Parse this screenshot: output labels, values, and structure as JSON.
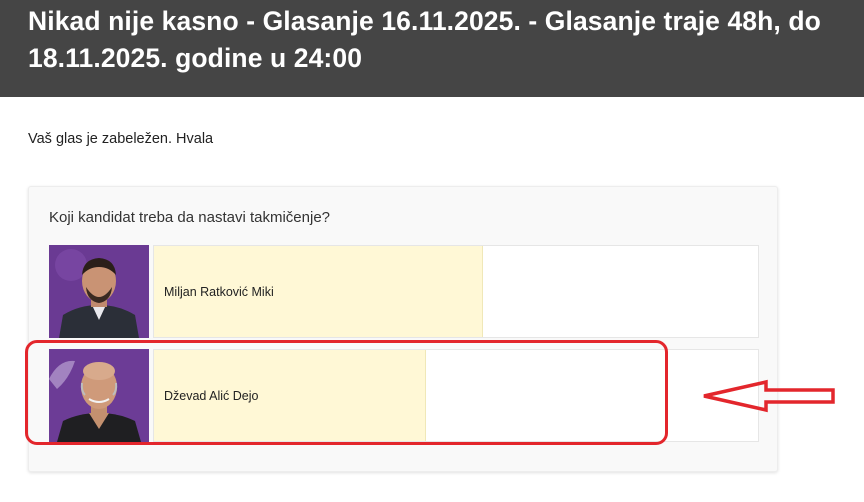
{
  "header": {
    "title": "Nikad nije kasno - Glasanje 16.11.2025. - Glasanje traje 48h, do 18.11.2025. godine u 24:00"
  },
  "vote_status": {
    "message": "Vaš glas je zabeležen. Hvala"
  },
  "poll": {
    "question": "Koji kandidat treba da nastavi takmičenje?",
    "options": [
      {
        "label": "Miljan Ratković Miki",
        "result_fraction": 0.545,
        "photo": "candidate-photo"
      },
      {
        "label": "Dževad Alić Dejo",
        "result_fraction": 0.45,
        "photo": "candidate-photo"
      }
    ]
  },
  "colors": {
    "header_bg": "#454545",
    "bar_fill": "#fff8d6",
    "annotation": "#e3262c"
  },
  "annotations": {
    "highlight": "red-rounded-rectangle",
    "pointer": "red-outline-arrow-left"
  }
}
